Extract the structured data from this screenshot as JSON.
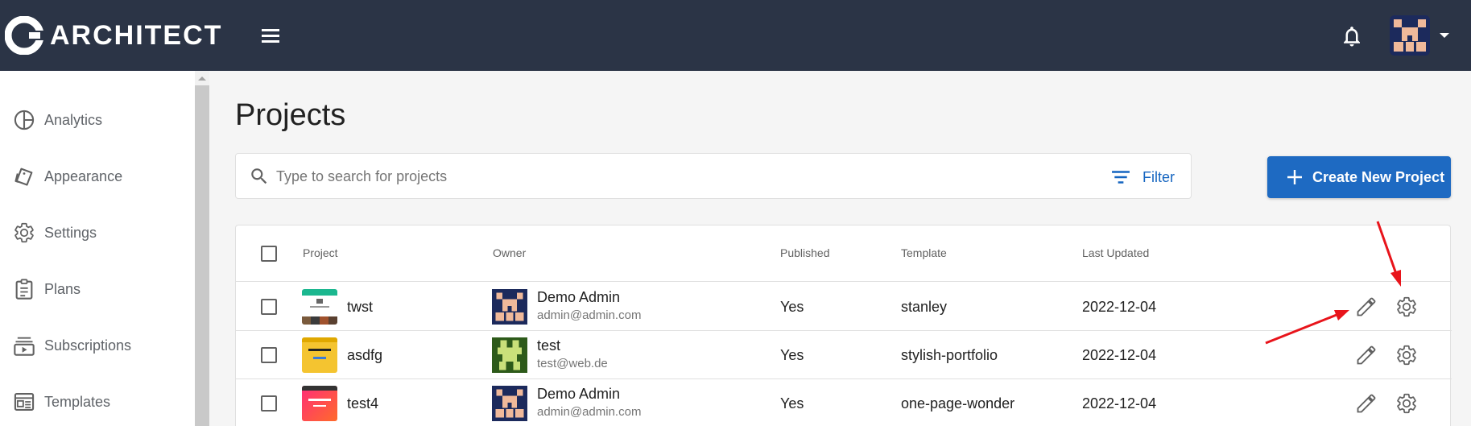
{
  "app": {
    "name": "ARCHITECT",
    "brand_color": "#2b3446",
    "accent_color": "#1e6ac2"
  },
  "topbar": {
    "menu_icon": "hamburger-menu-icon",
    "notification_icon": "bell-icon",
    "user_avatar_icon": "pixel-avatar-icon",
    "user_menu_icon": "caret-down-icon"
  },
  "sidebar": {
    "items": [
      {
        "label": "Analytics",
        "icon": "pie-chart-icon"
      },
      {
        "label": "Appearance",
        "icon": "appearance-icon"
      },
      {
        "label": "Settings",
        "icon": "gear-icon"
      },
      {
        "label": "Plans",
        "icon": "clipboard-icon"
      },
      {
        "label": "Subscriptions",
        "icon": "subscriptions-icon"
      },
      {
        "label": "Templates",
        "icon": "template-icon"
      }
    ]
  },
  "main": {
    "title": "Projects",
    "search": {
      "placeholder": "Type to search for projects",
      "value": ""
    },
    "filter_label": "Filter",
    "create_label": "Create New Project"
  },
  "table": {
    "columns": [
      "Project",
      "Owner",
      "Published",
      "Template",
      "Last Updated"
    ],
    "rows": [
      {
        "project": "twst",
        "owner_name": "Demo Admin",
        "owner_email": "admin@admin.com",
        "published": "Yes",
        "template": "stanley",
        "updated": "2022-12-04",
        "thumb": "stanley-thumbnail",
        "avatar": "pixel-avatar-blue"
      },
      {
        "project": "asdfg",
        "owner_name": "test",
        "owner_email": "test@web.de",
        "published": "Yes",
        "template": "stylish-portfolio",
        "updated": "2022-12-04",
        "thumb": "stylish-portfolio-thumbnail",
        "avatar": "pixel-avatar-green"
      },
      {
        "project": "test4",
        "owner_name": "Demo Admin",
        "owner_email": "admin@admin.com",
        "published": "Yes",
        "template": "one-page-wonder",
        "updated": "2022-12-04",
        "thumb": "one-page-wonder-thumbnail",
        "avatar": "pixel-avatar-blue"
      }
    ],
    "row_actions": [
      "pencil-icon",
      "gear-icon"
    ]
  },
  "annotations": {
    "arrow_color": "#e8141b"
  }
}
